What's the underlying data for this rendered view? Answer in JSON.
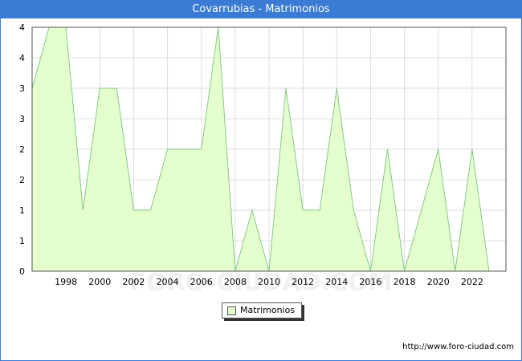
{
  "window": {
    "title": "Covarrubias - Matrimonios",
    "source_url": "http://www.foro-ciudad.com",
    "watermark": "FORO-CIUDAD.COM"
  },
  "colors": {
    "title_bar": "#3a7bd5",
    "area_fill": "#e5ffcc",
    "line": "#84c889",
    "grid": "#dddddd"
  },
  "chart_data": {
    "type": "area",
    "title": "Covarrubias - Matrimonios",
    "xlabel": "",
    "ylabel": "",
    "xlim": [
      1996,
      2024
    ],
    "ylim": [
      0,
      4
    ],
    "x_ticks": [
      "1998",
      "2000",
      "2002",
      "2004",
      "2006",
      "2008",
      "2010",
      "2012",
      "2014",
      "2016",
      "2018",
      "2020",
      "2022"
    ],
    "y_ticks": [
      "0",
      "1",
      "1",
      "2",
      "2",
      "3",
      "3",
      "4",
      "4"
    ],
    "grid": true,
    "legend_position": "bottom-center",
    "series": [
      {
        "name": "Matrimonios",
        "x": [
          1996,
          1997,
          1998,
          1999,
          2000,
          2001,
          2002,
          2003,
          2004,
          2005,
          2006,
          2007,
          2008,
          2009,
          2010,
          2011,
          2012,
          2013,
          2014,
          2015,
          2016,
          2017,
          2018,
          2019,
          2020,
          2021,
          2022,
          2023
        ],
        "values": [
          3,
          4,
          4,
          1,
          3,
          3,
          1,
          1,
          2,
          2,
          2,
          4,
          0,
          1,
          0,
          3,
          1,
          1,
          3,
          1,
          0,
          2,
          0,
          1,
          2,
          0,
          2,
          0
        ]
      }
    ]
  }
}
